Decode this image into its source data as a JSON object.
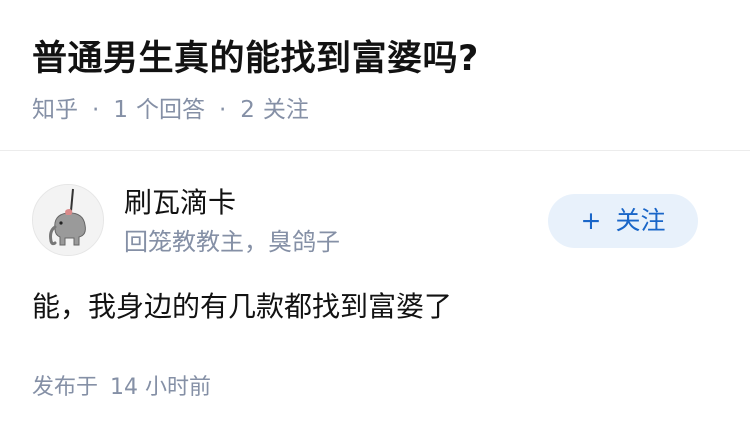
{
  "question": {
    "title": "普通男生真的能找到富婆吗?",
    "source": "知乎",
    "answer_count": "1",
    "answer_label": "个回答",
    "follow_count": "2",
    "follow_label": "关注",
    "separator": "·"
  },
  "answer": {
    "author_name": "刷瓦滴卡",
    "author_bio": "回笼教教主，臭鸽子",
    "avatar_icon": "elephant-balloon-icon",
    "follow_button": {
      "plus": "+",
      "label": "关注"
    },
    "content": "能，我身边的有几款都找到富婆了",
    "published_label": "发布于",
    "published_time": "14 小时前"
  },
  "colors": {
    "text_primary": "#121212",
    "text_secondary": "#8590a6",
    "follow_bg": "#e8f1fb",
    "follow_text": "#1a66c8"
  }
}
